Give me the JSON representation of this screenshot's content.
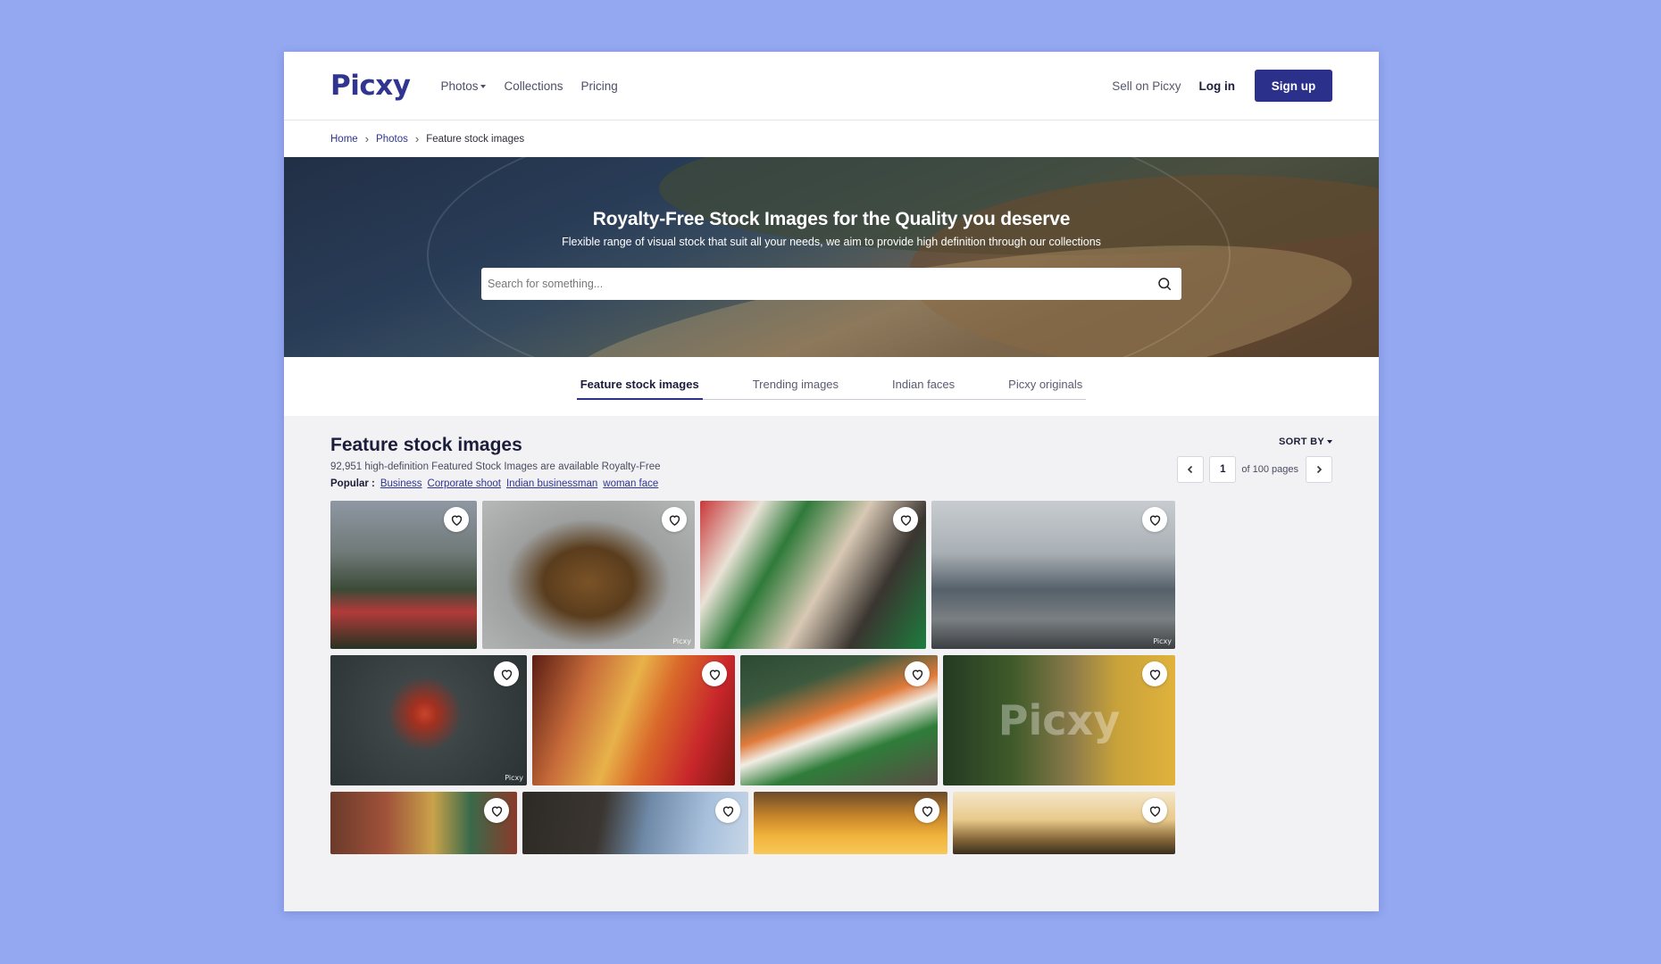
{
  "header": {
    "logo": "Picxy",
    "nav": {
      "photos": "Photos",
      "collections": "Collections",
      "pricing": "Pricing"
    },
    "sell": "Sell on Picxy",
    "login": "Log in",
    "signup": "Sign up"
  },
  "breadcrumb": [
    "Home",
    "Photos",
    "Feature stock images"
  ],
  "hero": {
    "title": "Royalty-Free Stock Images for the Quality you deserve",
    "subtitle": "Flexible range of visual stock that suit all your needs, we aim to provide high definition through our collections",
    "search_placeholder": "Search for something..."
  },
  "tabs": [
    "Feature stock images",
    "Trending images",
    "Indian faces",
    "Picxy originals"
  ],
  "section": {
    "title": "Feature stock images",
    "subtitle": "92,951 high-definition Featured Stock Images are available Royalty-Free",
    "popular_label": "Popular :",
    "popular_tags": [
      "Business",
      "Corporate shoot",
      "Indian businessman",
      "woman face"
    ]
  },
  "sort": {
    "label": "SORT BY"
  },
  "pager": {
    "current": "1",
    "of_label": "of 100 pages"
  },
  "images": {
    "watermark_small": "Picxy",
    "watermark_large": "Picxy",
    "rows": [
      [
        {
          "name": "train-passengers"
        },
        {
          "name": "bronze-manhole-statue"
        },
        {
          "name": "protest-flags"
        },
        {
          "name": "metro-platform"
        }
      ],
      [
        {
          "name": "idol-immersion"
        },
        {
          "name": "flower-crown-girls"
        },
        {
          "name": "indian-flag-crowd"
        },
        {
          "name": "group-banner"
        }
      ],
      [
        {
          "name": "temple-crowd"
        },
        {
          "name": "rock-cliff-sky"
        },
        {
          "name": "golden-sunset"
        },
        {
          "name": "field-sunset"
        }
      ]
    ]
  },
  "icons": {
    "heart": "heart-icon",
    "search": "search-icon",
    "chevron_left": "chevron-left-icon",
    "chevron_right": "chevron-right-icon"
  },
  "colors": {
    "accent": "#2b318b",
    "page_bg": "#94a8f2",
    "content_bg": "#f2f2f4"
  }
}
